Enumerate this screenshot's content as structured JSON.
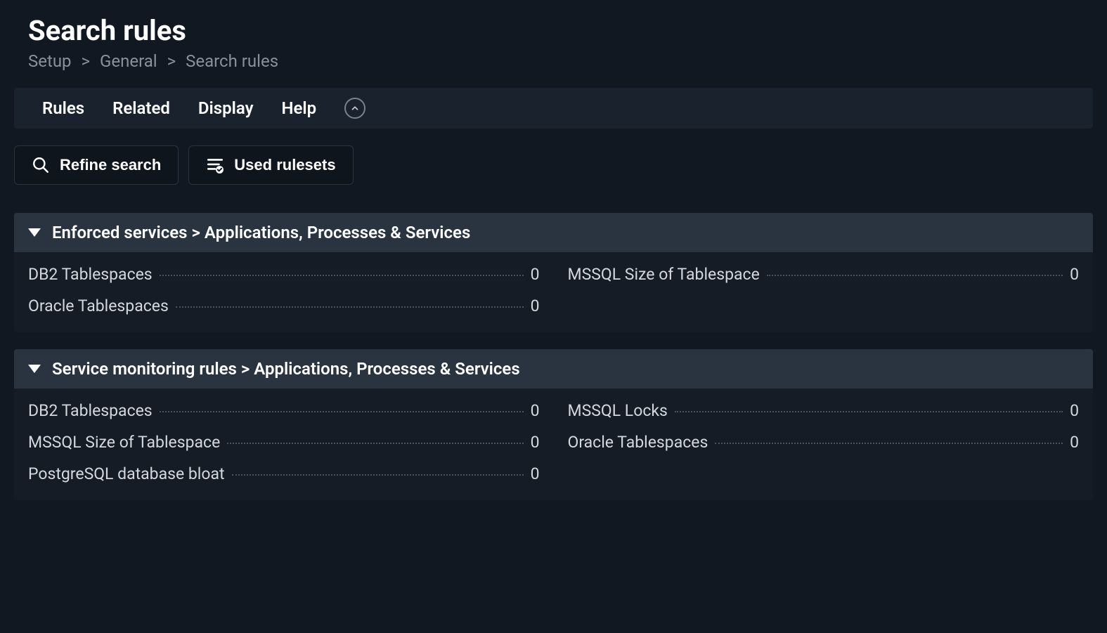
{
  "page_title": "Search rules",
  "breadcrumb": [
    "Setup",
    "General",
    "Search rules"
  ],
  "menubar": {
    "items": [
      "Rules",
      "Related",
      "Display",
      "Help"
    ]
  },
  "toolbar": {
    "refine_label": "Refine search",
    "used_label": "Used rulesets"
  },
  "sections": [
    {
      "title": "Enforced services > Applications, Processes & Services",
      "rules": [
        {
          "label": "DB2 Tablespaces",
          "count": 0
        },
        {
          "label": "MSSQL Size of Tablespace",
          "count": 0
        },
        {
          "label": "Oracle Tablespaces",
          "count": 0
        }
      ]
    },
    {
      "title": "Service monitoring rules > Applications, Processes & Services",
      "rules": [
        {
          "label": "DB2 Tablespaces",
          "count": 0
        },
        {
          "label": "MSSQL Locks",
          "count": 0
        },
        {
          "label": "MSSQL Size of Tablespace",
          "count": 0
        },
        {
          "label": "Oracle Tablespaces",
          "count": 0
        },
        {
          "label": "PostgreSQL database bloat",
          "count": 0
        }
      ]
    }
  ]
}
